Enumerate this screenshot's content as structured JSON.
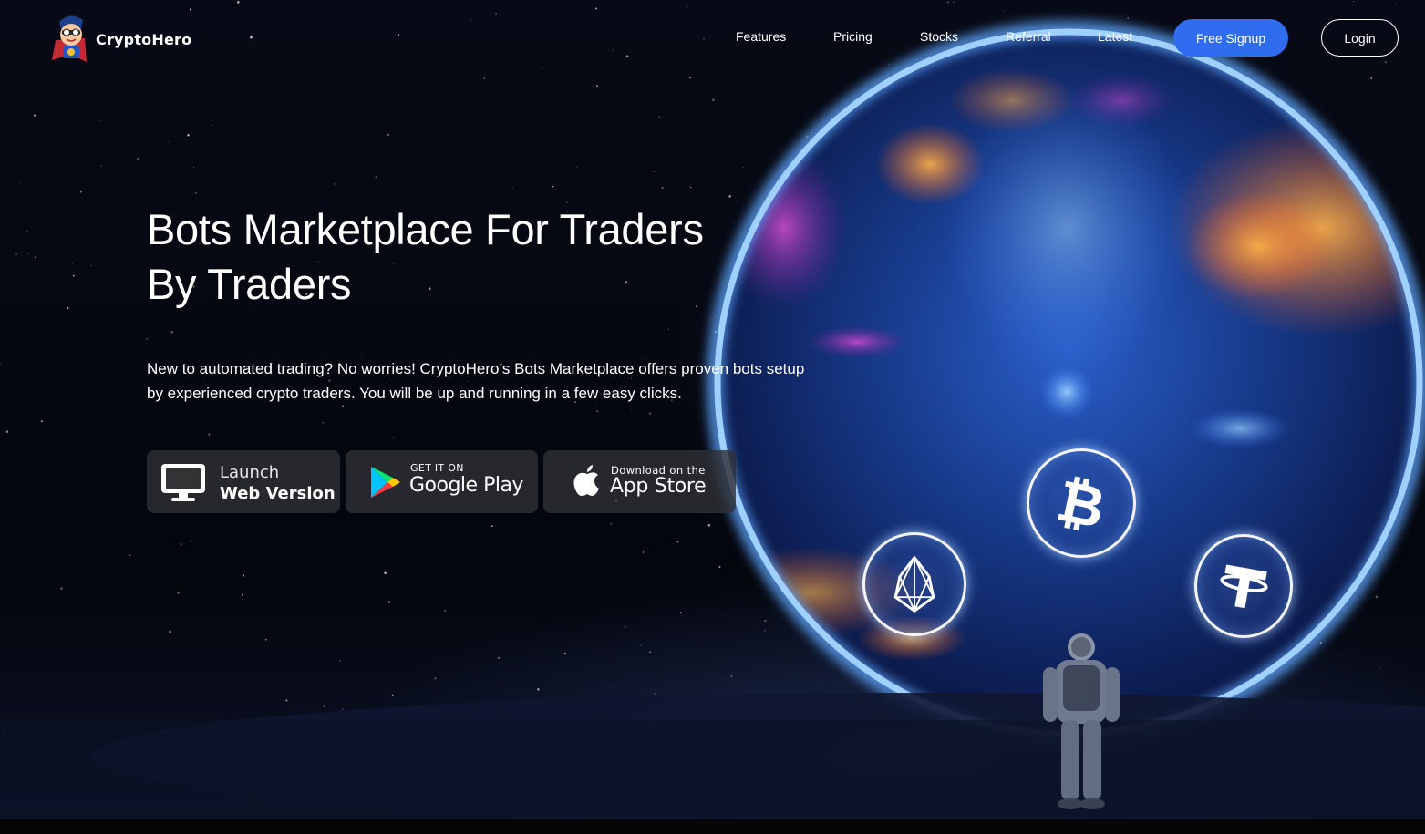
{
  "header": {
    "brand": "CryptoHero",
    "nav": [
      "Features",
      "Pricing",
      "Stocks",
      "Referral",
      "Latest"
    ],
    "signup_label": "Free Signup",
    "login_label": "Login"
  },
  "hero": {
    "headline_line1": "Bots Marketplace For Traders",
    "headline_line2": "By Traders",
    "description": "New to automated trading? No worries! CryptoHero’s Bots Marketplace offers proven bots setup by experienced crypto traders. You will be up and running in a few easy clicks."
  },
  "buttons": {
    "web": {
      "small": "Launch",
      "big": "Web Version",
      "icon": "monitor-icon"
    },
    "google_play": {
      "small": "GET IT ON",
      "big": "Google Play",
      "icon": "google-play-icon"
    },
    "app_store": {
      "small": "Download on the",
      "big": "App Store",
      "icon": "apple-icon"
    }
  },
  "coins": [
    "eos-icon",
    "bitcoin-icon",
    "tether-icon"
  ],
  "colors": {
    "accent": "#2f6cf0",
    "portal_ring": "#7fb8ff",
    "background": "#05070f"
  }
}
